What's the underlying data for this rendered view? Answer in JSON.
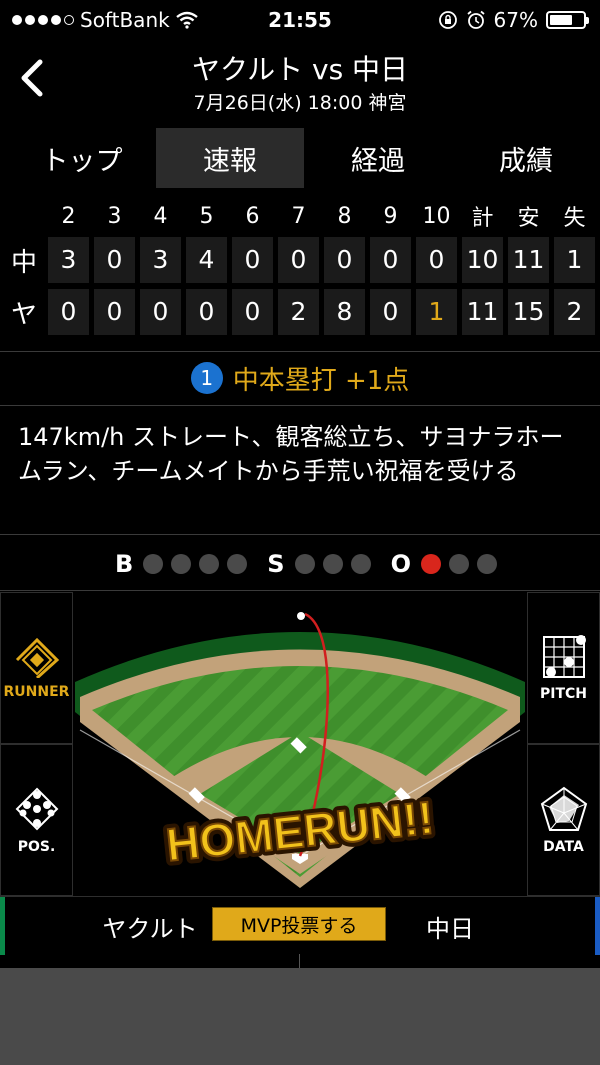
{
  "status_bar": {
    "carrier": "SoftBank",
    "time": "21:55",
    "battery": "67%"
  },
  "header": {
    "title": "ヤクルト vs 中日",
    "subtitle": "7月26日(水) 18:00 神宮"
  },
  "tabs": [
    {
      "label": "トップ",
      "active": false
    },
    {
      "label": "速報",
      "active": true
    },
    {
      "label": "経過",
      "active": false
    },
    {
      "label": "成績",
      "active": false
    }
  ],
  "scoreboard": {
    "headers": [
      "2",
      "3",
      "4",
      "5",
      "6",
      "7",
      "8",
      "9",
      "10",
      "計",
      "安",
      "失"
    ],
    "rows": [
      {
        "team": "中",
        "values": [
          "3",
          "0",
          "3",
          "4",
          "0",
          "0",
          "0",
          "0",
          "0",
          "10",
          "11",
          "1"
        ]
      },
      {
        "team": "ヤ",
        "values": [
          "0",
          "0",
          "0",
          "0",
          "0",
          "2",
          "8",
          "0",
          "1",
          "11",
          "15",
          "2"
        ]
      }
    ]
  },
  "play": {
    "number": "1",
    "title": "中本塁打 +1点",
    "description": "147km/h ストレート、観客総立ち、サヨナラホームラン、チームメイトから手荒い祝福を受ける"
  },
  "count": {
    "b_label": "B",
    "s_label": "S",
    "o_label": "O",
    "balls": 0,
    "strikes": 0,
    "outs": 1
  },
  "side_buttons": {
    "runner": "RUNNER",
    "pos": "POS.",
    "pitch": "PITCH",
    "data": "DATA"
  },
  "field": {
    "banner": "HOMERUN!!"
  },
  "bottom": {
    "home_team": "ヤクルト",
    "mvp_button": "MVP投票する",
    "away_team": "中日"
  },
  "colors": {
    "accent_gold": "#e0a91a",
    "badge_blue": "#1b72d0",
    "out_red": "#d9261c"
  }
}
